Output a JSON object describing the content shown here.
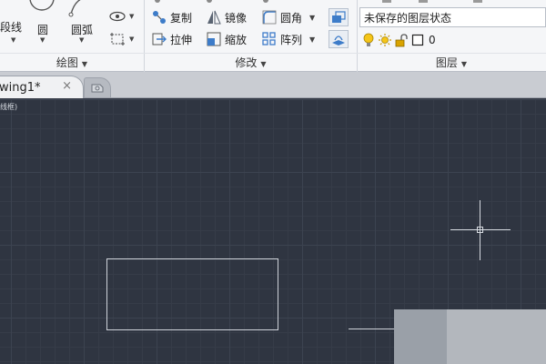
{
  "ribbon": {
    "draw_panel": {
      "title": "绘图",
      "polyline_label": "段线",
      "circle_label": "圆",
      "arc_label": "圆弧"
    },
    "modify_panel": {
      "title": "修改",
      "copy_label": "复制",
      "mirror_label": "镜像",
      "fillet_label": "圆角",
      "stretch_label": "拉伸",
      "scale_label": "缩放",
      "array_label": "阵列"
    },
    "layers_panel": {
      "title": "图层",
      "layer_state": "未保存的图层状态",
      "current_layer": "0"
    }
  },
  "tabs": {
    "document_title": "wing1*",
    "close_glyph": "×"
  },
  "viewport": {
    "label": "线框)"
  },
  "colors": {
    "canvas": "#2f3541",
    "grid_major": "#3c4350",
    "grid_minor": "#363c48",
    "geometry": "#cfd3da",
    "ribbon_bg": "#f5f6f8"
  }
}
